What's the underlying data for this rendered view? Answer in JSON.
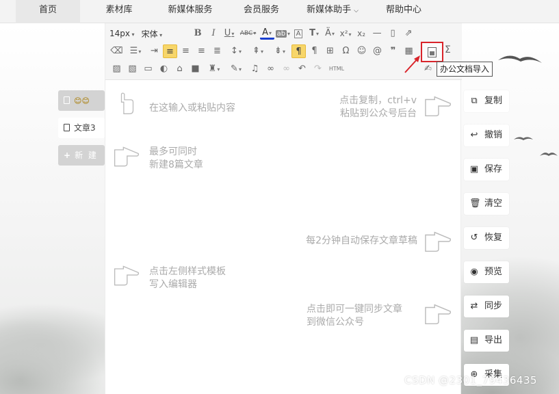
{
  "nav": {
    "items": [
      {
        "label": "首页",
        "active": true
      },
      {
        "label": "素材库"
      },
      {
        "label": "新媒体服务"
      },
      {
        "label": "会员服务"
      },
      {
        "label": "新媒体助手"
      },
      {
        "label": "帮助中心"
      }
    ]
  },
  "left": {
    "doc1_icons": "😊😊",
    "doc2_label": "文章3",
    "new_label": "新 建"
  },
  "toolbar": {
    "font_size": "14px",
    "font_family": "宋体",
    "html_label": "HTML",
    "tooltip": "办公文档导入"
  },
  "hints": {
    "input": "在这输入或粘贴内容",
    "copy_line1": "点击复制，ctrl+v",
    "copy_line2": "粘贴到公众号后台",
    "max_line1": "最多可同时",
    "max_line2": "新建8篇文章",
    "autosave": "每2分钟自动保存文章草稿",
    "template_line1": "点击左侧样式模板",
    "template_line2": "写入编辑器",
    "sync_line1": "点击即可一键同步文章",
    "sync_line2": "到微信公众号"
  },
  "side_buttons": [
    {
      "label": "复制",
      "icon": "copy-icon"
    },
    {
      "label": "撤销",
      "icon": "undo-icon"
    },
    {
      "label": "保存",
      "icon": "save-icon"
    },
    {
      "label": "清空",
      "icon": "trash-icon"
    },
    {
      "label": "恢复",
      "icon": "restore-icon"
    },
    {
      "label": "预览",
      "icon": "eye-icon"
    },
    {
      "label": "同步",
      "icon": "sync-icon"
    },
    {
      "label": "导出",
      "icon": "export-icon"
    },
    {
      "label": "采集",
      "icon": "collect-icon"
    }
  ],
  "watermark": "CSDN @2301_79436435",
  "colors": {
    "highlight_red": "#d9242a",
    "active_yellow": "#f7d66a",
    "hint_grey": "#aaaaaa"
  }
}
